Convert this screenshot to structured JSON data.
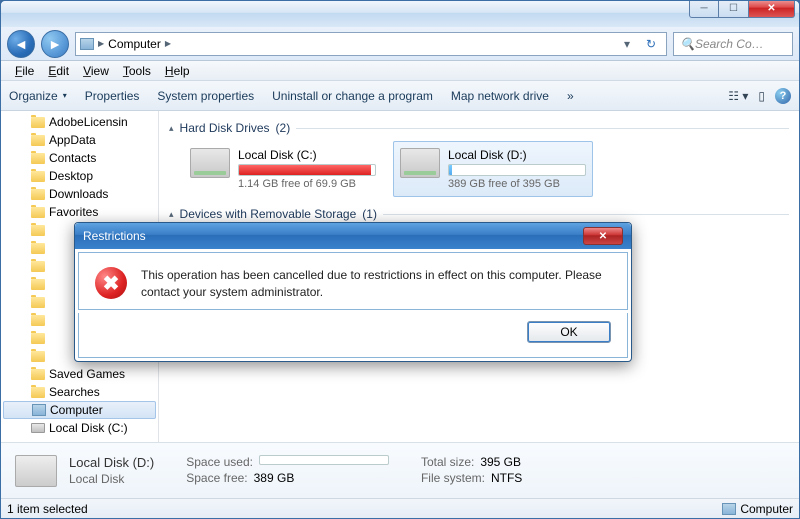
{
  "window": {
    "title": "Computer"
  },
  "nav": {
    "crumb1": "Computer",
    "crumb2": ""
  },
  "search": {
    "placeholder": "Search Co…"
  },
  "menu": {
    "file": "File",
    "edit": "Edit",
    "view": "View",
    "tools": "Tools",
    "help": "Help"
  },
  "toolbar": {
    "organize": "Organize",
    "properties": "Properties",
    "sysprops": "System properties",
    "uninstall": "Uninstall or change a program",
    "mapdrive": "Map network drive",
    "more": "»"
  },
  "tree": [
    {
      "label": "AdobeLicensin",
      "kind": "folder",
      "lvl": 1
    },
    {
      "label": "AppData",
      "kind": "folder",
      "lvl": 1
    },
    {
      "label": "Contacts",
      "kind": "folder",
      "lvl": 1
    },
    {
      "label": "Desktop",
      "kind": "folder",
      "lvl": 1
    },
    {
      "label": "Downloads",
      "kind": "folder",
      "lvl": 1
    },
    {
      "label": "Favorites",
      "kind": "folder",
      "lvl": 1
    },
    {
      "label": "",
      "kind": "folder",
      "lvl": 1
    },
    {
      "label": "",
      "kind": "folder",
      "lvl": 1
    },
    {
      "label": "",
      "kind": "folder",
      "lvl": 1
    },
    {
      "label": "",
      "kind": "folder",
      "lvl": 1
    },
    {
      "label": "",
      "kind": "folder",
      "lvl": 1
    },
    {
      "label": "",
      "kind": "folder",
      "lvl": 1
    },
    {
      "label": "",
      "kind": "folder",
      "lvl": 1
    },
    {
      "label": "",
      "kind": "folder",
      "lvl": 1
    },
    {
      "label": "Saved Games",
      "kind": "folder",
      "lvl": 1
    },
    {
      "label": "Searches",
      "kind": "folder",
      "lvl": 1
    },
    {
      "label": "Computer",
      "kind": "computer",
      "lvl": 0,
      "sel": true
    },
    {
      "label": "Local Disk (C:)",
      "kind": "disk",
      "lvl": 1
    }
  ],
  "groups": {
    "hdd": {
      "title": "Hard Disk Drives",
      "count": "(2)"
    },
    "removable": {
      "title": "Devices with Removable Storage",
      "count": "(1)"
    }
  },
  "drives": [
    {
      "label": "Local Disk (C:)",
      "free": "1.14 GB free of 69.9 GB",
      "fillclass": "red"
    },
    {
      "label": "Local Disk (D:)",
      "free": "389 GB free of 395 GB",
      "fillclass": "blue",
      "sel": true
    }
  ],
  "details": {
    "title": "Local Disk (D:)",
    "subtitle": "Local Disk",
    "space_used_label": "Space used:",
    "space_free_label": "Space free:",
    "space_free": "389 GB",
    "total_label": "Total size:",
    "total": "395 GB",
    "fs_label": "File system:",
    "fs": "NTFS"
  },
  "status": {
    "left": "1 item selected",
    "right": "Computer"
  },
  "dialog": {
    "title": "Restrictions",
    "message": "This operation has been cancelled due to restrictions in effect on this computer. Please contact your system administrator.",
    "ok": "OK"
  }
}
